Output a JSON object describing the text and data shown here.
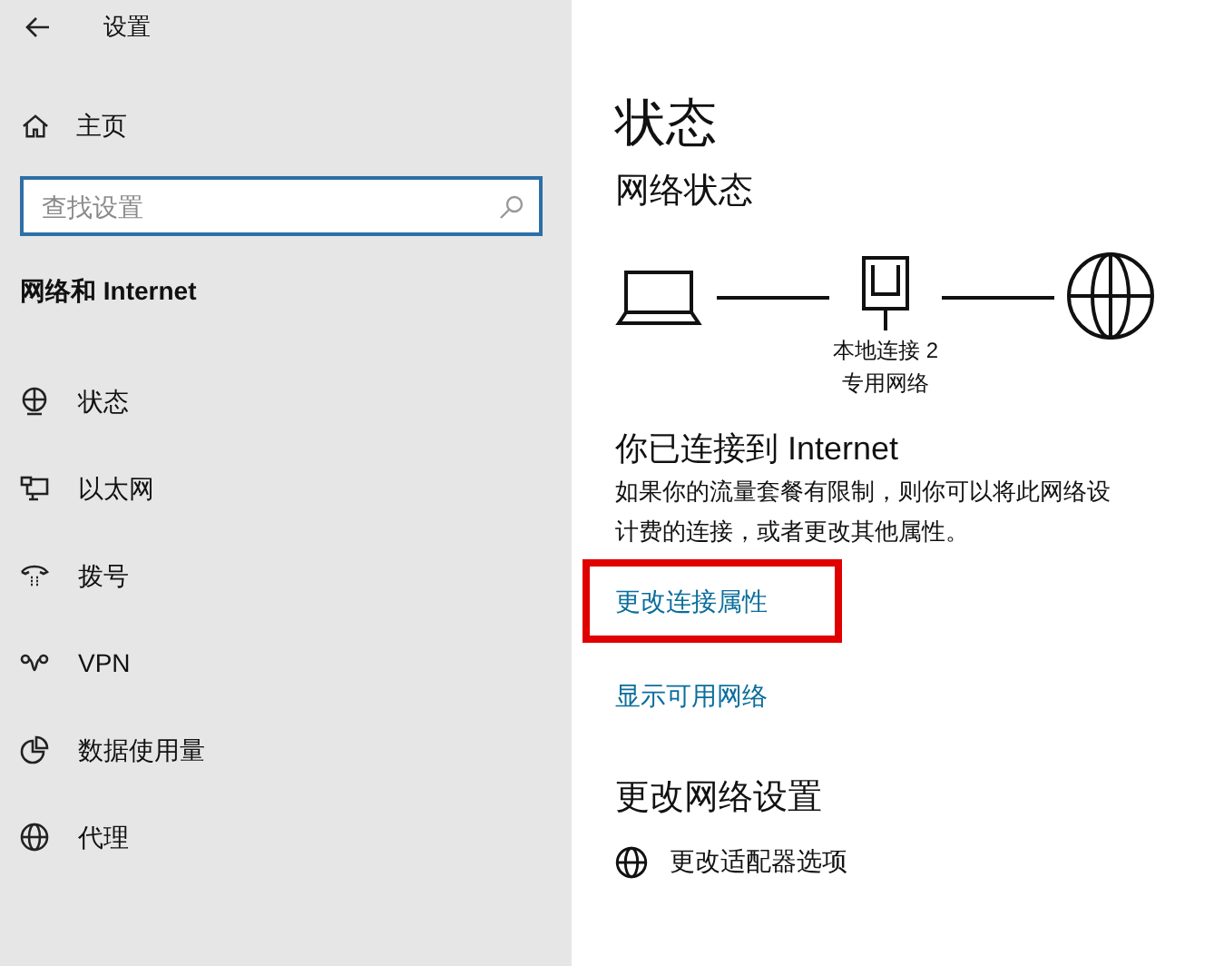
{
  "window": {
    "title": "设置"
  },
  "sidebar": {
    "home": "主页",
    "search": {
      "placeholder": "查找设置"
    },
    "section": "网络和 Internet",
    "items": [
      {
        "label": "状态",
        "kind": "status",
        "selected": false
      },
      {
        "label": "以太网",
        "kind": "ethernet",
        "selected": false
      },
      {
        "label": "拨号",
        "kind": "dialup",
        "selected": false
      },
      {
        "label": "VPN",
        "kind": "vpn",
        "selected": false
      },
      {
        "label": "数据使用量",
        "kind": "data",
        "selected": false
      },
      {
        "label": "代理",
        "kind": "proxy",
        "selected": false
      }
    ]
  },
  "main": {
    "title": "状态",
    "network_status": {
      "heading": "网络状态",
      "adapter": "本地连接 2",
      "network_type": "专用网络"
    },
    "connected": {
      "heading": "你已连接到 Internet",
      "description_lines": [
        "如果你的流量套餐有限制，则你可以将此网络设",
        "计费的连接，或者更改其他属性。"
      ]
    },
    "links": [
      {
        "label": "更改连接属性",
        "highlighted": true
      },
      {
        "label": "显示可用网络",
        "highlighted": false
      }
    ],
    "change_settings": {
      "heading": "更改网络设置",
      "items": [
        {
          "label": "更改适配器选项"
        }
      ]
    }
  }
}
